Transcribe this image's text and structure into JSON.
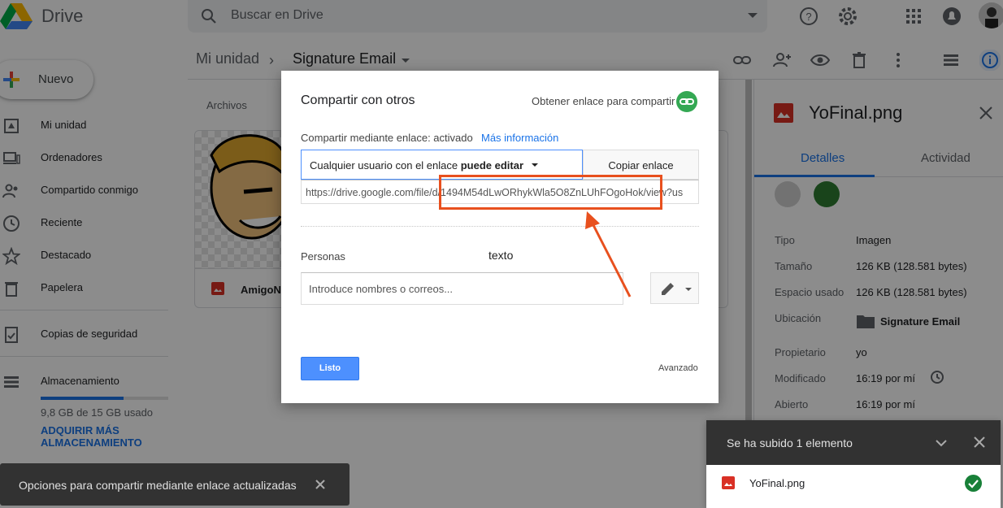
{
  "app": {
    "brand": "Drive",
    "search_placeholder": "Buscar en Drive",
    "new_label": "Nuevo",
    "breadcrumb": {
      "root": "Mi unidad",
      "current": "Signature Email"
    },
    "sidebar": {
      "items": [
        {
          "label": "Mi unidad",
          "icon": "drive-icon"
        },
        {
          "label": "Ordenadores",
          "icon": "computer-icon"
        },
        {
          "label": "Compartido conmigo",
          "icon": "people-icon"
        },
        {
          "label": "Reciente",
          "icon": "clock-icon"
        },
        {
          "label": "Destacado",
          "icon": "star-icon"
        },
        {
          "label": "Papelera",
          "icon": "trash-icon"
        },
        {
          "label": "Copias de seguridad",
          "icon": "backup-icon"
        },
        {
          "label": "Almacenamiento",
          "icon": "storage-icon"
        }
      ],
      "storage_used": "9,8 GB de 15 GB usado",
      "storage_fraction": 0.65,
      "buy_more": "ADQUIRIR MÁS ALMACENAMIENTO"
    },
    "files_label": "Archivos",
    "file_name": "AmigoNa"
  },
  "details": {
    "title": "YoFinal.png",
    "tabs": [
      "Detalles",
      "Actividad"
    ],
    "props": [
      {
        "key": "Tipo",
        "value": "Imagen"
      },
      {
        "key": "Tamaño",
        "value": "126 KB (128.581 bytes)"
      },
      {
        "key": "Espacio usado",
        "value": "126 KB (128.581 bytes)"
      },
      {
        "key": "Ubicación",
        "value": "Signature Email"
      },
      {
        "key": "Propietario",
        "value": "yo"
      },
      {
        "key": "Modificado",
        "value": "16:19 por mí"
      },
      {
        "key": "Abierto",
        "value": "16:19 por mí"
      }
    ]
  },
  "dialog": {
    "title": "Compartir con otros",
    "get_link": "Obtener enlace para compartir",
    "share_status": "Compartir mediante enlace: activado",
    "more_info": "Más información",
    "permission_prefix": "Cualquier usuario con el enlace ",
    "permission_bold": "puede editar",
    "copy_link": "Copiar enlace",
    "url": "https://drive.google.com/file/d/1494M54dLwORhykWla5O8ZnLUhFOgoHok/view?us",
    "people_label": "Personas",
    "annotation": "texto",
    "people_placeholder": "Introduce nombres o correos...",
    "done": "Listo",
    "advanced": "Avanzado"
  },
  "toasts": {
    "link_updated": "Opciones para compartir mediante enlace actualizadas",
    "upload_header": "Se ha subido 1 elemento",
    "upload_file": "YoFinal.png"
  },
  "colors": {
    "accent": "#1a73e8",
    "done_button": "#4d90fe",
    "annotation": "#e8501e",
    "link_green": "#34a853"
  }
}
